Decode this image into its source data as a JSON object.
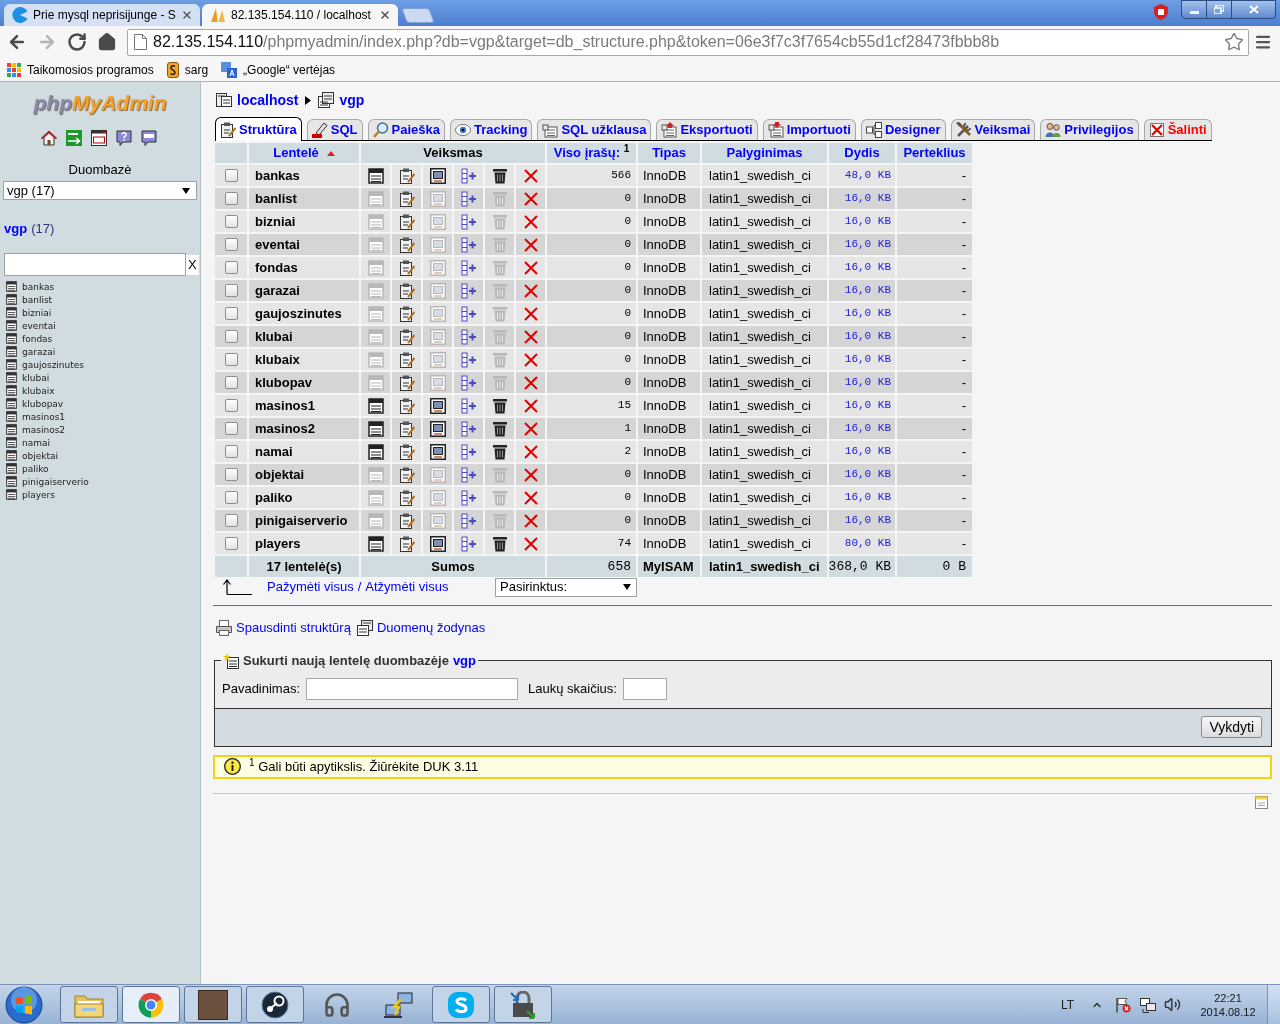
{
  "browser": {
    "tabs": [
      {
        "title": "Prie mysql neprisijunge - S",
        "kind": "forum",
        "selected": false
      },
      {
        "title": "82.135.154.110 / localhost",
        "kind": "pma",
        "selected": true
      }
    ],
    "navigation": [
      {
        "kind": "back",
        "disabled": false
      },
      {
        "kind": "forward",
        "disabled": true
      },
      {
        "kind": "reload",
        "disabled": false
      },
      {
        "kind": "home",
        "disabled": false
      }
    ],
    "address": {
      "host": "82.135.154.110",
      "path": "/phpmyadmin/index.php?db=vgp&target=db_structure.php&token=06e3f7c3f7654cb55d1cf28473fbbb8b"
    },
    "bookmarks": [
      {
        "label": "Taikomosios programos",
        "kind": "apps"
      },
      {
        "label": "sarg",
        "kind": "page"
      },
      {
        "label": "„Google“ vertėjas",
        "kind": "translate"
      }
    ]
  },
  "sidebar": {
    "logo": [
      "php",
      "MyAdmin"
    ],
    "database_label": "Duombazė",
    "database_select": "vgp (17)",
    "db_heading": {
      "name": "vgp",
      "count": "(17)"
    },
    "filter_clear": "X",
    "tables": [
      "bankas",
      "banlist",
      "bizniai",
      "eventai",
      "fondas",
      "garazai",
      "gaujoszinutes",
      "klubai",
      "klubaix",
      "klubopav",
      "masinos1",
      "masinos2",
      "namai",
      "objektai",
      "paliko",
      "pinigaiserverio",
      "players"
    ]
  },
  "breadcrumb": [
    {
      "label": "localhost",
      "kind": "server"
    },
    {
      "label": "vgp",
      "kind": "database"
    }
  ],
  "tabs": [
    {
      "label": "Struktūra",
      "kind": "structure",
      "selected": true
    },
    {
      "label": "SQL",
      "kind": "sql",
      "selected": false
    },
    {
      "label": "Paieška",
      "kind": "search",
      "selected": false
    },
    {
      "label": "Tracking",
      "kind": "tracking",
      "selected": false
    },
    {
      "label": "SQL užklausa",
      "kind": "query",
      "selected": false
    },
    {
      "label": "Eksportuoti",
      "kind": "export",
      "selected": false
    },
    {
      "label": "Importuoti",
      "kind": "import",
      "selected": false
    },
    {
      "label": "Designer",
      "kind": "designer",
      "selected": false
    },
    {
      "label": "Veiksmai",
      "kind": "operations",
      "selected": false
    },
    {
      "label": "Privilegijos",
      "kind": "privileges",
      "selected": false
    },
    {
      "label": "Šalinti",
      "kind": "drop",
      "selected": false
    }
  ],
  "table": {
    "columns": [
      {
        "label": "Lentelė",
        "link": true,
        "sorted": true
      },
      {
        "label": "Veiksmas",
        "link": false,
        "sorted": false
      },
      {
        "label": "Viso įrašų: $^{1}$",
        "link": true,
        "sorted": false
      },
      {
        "label": "Tipas",
        "link": true,
        "sorted": false
      },
      {
        "label": "Palyginimas",
        "link": true,
        "sorted": false
      },
      {
        "label": "Dydis",
        "link": true,
        "sorted": false
      },
      {
        "label": "Perteklius",
        "link": true,
        "sorted": false
      }
    ],
    "rows": [
      {
        "name": "bankas",
        "checked": false,
        "empty": false,
        "records": "566",
        "type": "InnoDB",
        "collation": "latin1_swedish_ci",
        "size": "48,0 KB",
        "overhead": "-"
      },
      {
        "name": "banlist",
        "checked": false,
        "empty": true,
        "records": "0",
        "type": "InnoDB",
        "collation": "latin1_swedish_ci",
        "size": "16,0 KB",
        "overhead": "-"
      },
      {
        "name": "bizniai",
        "checked": false,
        "empty": true,
        "records": "0",
        "type": "InnoDB",
        "collation": "latin1_swedish_ci",
        "size": "16,0 KB",
        "overhead": "-"
      },
      {
        "name": "eventai",
        "checked": false,
        "empty": true,
        "records": "0",
        "type": "InnoDB",
        "collation": "latin1_swedish_ci",
        "size": "16,0 KB",
        "overhead": "-"
      },
      {
        "name": "fondas",
        "checked": false,
        "empty": true,
        "records": "0",
        "type": "InnoDB",
        "collation": "latin1_swedish_ci",
        "size": "16,0 KB",
        "overhead": "-"
      },
      {
        "name": "garazai",
        "checked": false,
        "empty": true,
        "records": "0",
        "type": "InnoDB",
        "collation": "latin1_swedish_ci",
        "size": "16,0 KB",
        "overhead": "-"
      },
      {
        "name": "gaujoszinutes",
        "checked": false,
        "empty": true,
        "records": "0",
        "type": "InnoDB",
        "collation": "latin1_swedish_ci",
        "size": "16,0 KB",
        "overhead": "-"
      },
      {
        "name": "klubai",
        "checked": false,
        "empty": true,
        "records": "0",
        "type": "InnoDB",
        "collation": "latin1_swedish_ci",
        "size": "16,0 KB",
        "overhead": "-"
      },
      {
        "name": "klubaix",
        "checked": false,
        "empty": true,
        "records": "0",
        "type": "InnoDB",
        "collation": "latin1_swedish_ci",
        "size": "16,0 KB",
        "overhead": "-"
      },
      {
        "name": "klubopav",
        "checked": false,
        "empty": true,
        "records": "0",
        "type": "InnoDB",
        "collation": "latin1_swedish_ci",
        "size": "16,0 KB",
        "overhead": "-"
      },
      {
        "name": "masinos1",
        "checked": false,
        "empty": false,
        "records": "15",
        "type": "InnoDB",
        "collation": "latin1_swedish_ci",
        "size": "16,0 KB",
        "overhead": "-"
      },
      {
        "name": "masinos2",
        "checked": false,
        "empty": false,
        "records": "1",
        "type": "InnoDB",
        "collation": "latin1_swedish_ci",
        "size": "16,0 KB",
        "overhead": "-"
      },
      {
        "name": "namai",
        "checked": false,
        "empty": false,
        "records": "2",
        "type": "InnoDB",
        "collation": "latin1_swedish_ci",
        "size": "16,0 KB",
        "overhead": "-"
      },
      {
        "name": "objektai",
        "checked": false,
        "empty": true,
        "records": "0",
        "type": "InnoDB",
        "collation": "latin1_swedish_ci",
        "size": "16,0 KB",
        "overhead": "-"
      },
      {
        "name": "paliko",
        "checked": false,
        "empty": true,
        "records": "0",
        "type": "InnoDB",
        "collation": "latin1_swedish_ci",
        "size": "16,0 KB",
        "overhead": "-"
      },
      {
        "name": "pinigaiserverio",
        "checked": false,
        "empty": true,
        "records": "0",
        "type": "InnoDB",
        "collation": "latin1_swedish_ci",
        "size": "16,0 KB",
        "overhead": "-"
      },
      {
        "name": "players",
        "checked": false,
        "empty": false,
        "records": "74",
        "type": "InnoDB",
        "collation": "latin1_swedish_ci",
        "size": "80,0 KB",
        "overhead": "-"
      }
    ],
    "summary": {
      "count": "17 lentelė(s)",
      "label": "Sumos",
      "records": "658",
      "type": "MyISAM",
      "collation": "latin1_swedish_ci",
      "size": "368,0 KB",
      "overhead": "0 B"
    }
  },
  "bulk": {
    "check_all": "Pažymėti visus",
    "separator": "/",
    "uncheck_all": "Atžymėti visus",
    "with_selected": "Pasirinktus:"
  },
  "links": [
    {
      "label": "Spausdinti struktūrą",
      "kind": "print"
    },
    {
      "label": "Duomenų žodynas",
      "kind": "dictionary"
    }
  ],
  "create_table": {
    "legend": "Sukurti naują lentelę duombazėje",
    "db": "vgp",
    "name_label": "Pavadinimas:",
    "fields_label": "Laukų skaičius:",
    "submit": "Vykdyti"
  },
  "notice": "$^{1}$ Gali būti apytikslis. Žiūrėkite DUK 3.11",
  "taskbar": {
    "apps": [
      {
        "kind": "folder",
        "running": true,
        "active": false
      },
      {
        "kind": "browser",
        "running": true,
        "active": true
      },
      {
        "kind": "photo",
        "running": true,
        "active": false
      },
      {
        "kind": "steam",
        "running": true,
        "active": false
      },
      {
        "kind": "headset",
        "running": false,
        "active": false
      },
      {
        "kind": "network",
        "running": false,
        "active": false
      },
      {
        "kind": "skype",
        "running": true,
        "active": false
      },
      {
        "kind": "lock",
        "running": true,
        "active": false
      }
    ],
    "language": "LT",
    "time": "22:21",
    "date": "2014.08.12"
  }
}
